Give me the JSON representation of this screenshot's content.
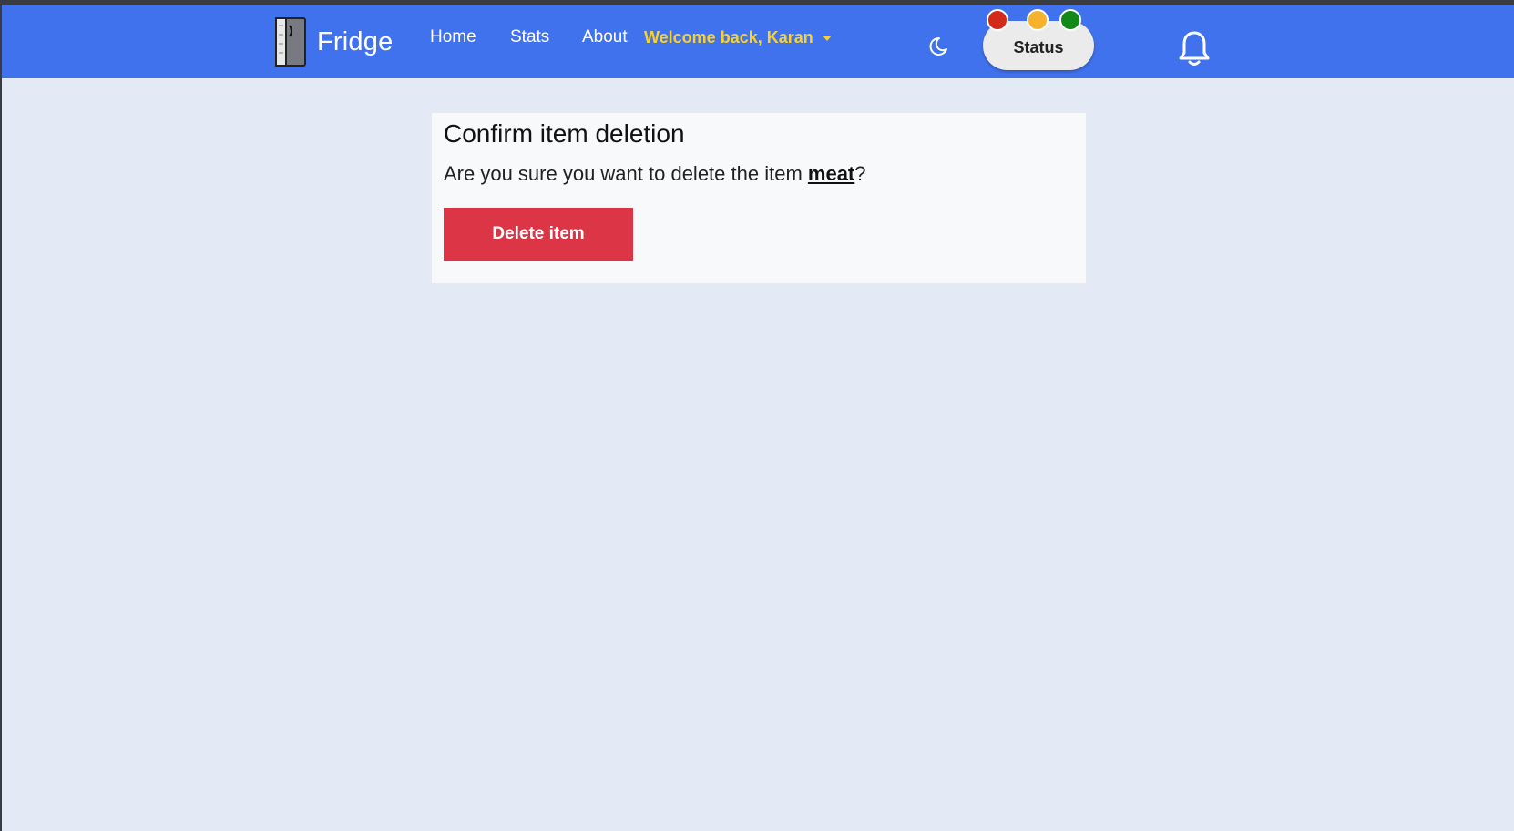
{
  "navbar": {
    "brand_text": "Fridge",
    "links": {
      "home": "Home",
      "stats": "Stats",
      "about": "About"
    },
    "welcome_text": "Welcome back, Karan",
    "status_label": "Status"
  },
  "icons": {
    "brand": "fridge-icon",
    "theme_toggle": "moon-icon",
    "dropdown": "caret-down-icon",
    "notifications": "bell-icon"
  },
  "colors": {
    "navbar_bg": "#4172ee",
    "welcome_text": "#f8d12d",
    "status_red": "#d42a1a",
    "status_amber": "#f6b22c",
    "status_green": "#138a17",
    "danger_button": "#dc3545",
    "page_bg": "#e3e9f5"
  },
  "card": {
    "title": "Confirm item deletion",
    "message_before": "Are you sure you want to delete the item ",
    "item_name": "meat",
    "message_after": "?",
    "delete_button_label": "Delete item"
  }
}
